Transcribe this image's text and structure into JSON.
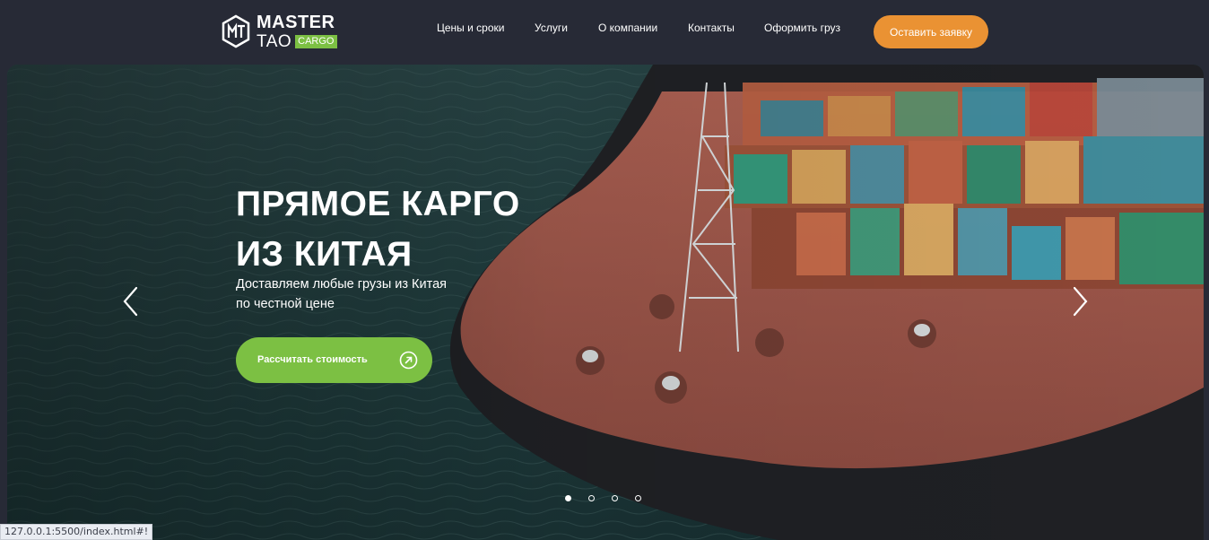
{
  "brand": {
    "line1": "MASTER",
    "line2": "TAO",
    "badge": "CARGO",
    "accent": "#7cc043"
  },
  "nav": {
    "items": [
      {
        "label": "Цены и сроки"
      },
      {
        "label": "Услуги"
      },
      {
        "label": "О компании"
      },
      {
        "label": "Контакты"
      },
      {
        "label": "Оформить груз"
      }
    ],
    "cta_label": "Оставить заявку",
    "cta_color": "#ea9233"
  },
  "hero": {
    "title_line1": "ПРЯМОЕ КАРГО",
    "title_line2": "ИЗ КИТАЯ",
    "subtitle_line1": "Доставляем любые грузы из Китая",
    "subtitle_line2": "по честной цене",
    "button_label": "Рассчитать стоимость",
    "button_icon": "arrow-up-right-icon",
    "prev_icon": "chevron-left-icon",
    "next_icon": "chevron-right-icon",
    "background_image": "container-ship-aerial-photo",
    "slides_total": 4,
    "active_slide": 1
  },
  "status_bar": {
    "url": "127.0.0.1:5500/index.html#!"
  }
}
